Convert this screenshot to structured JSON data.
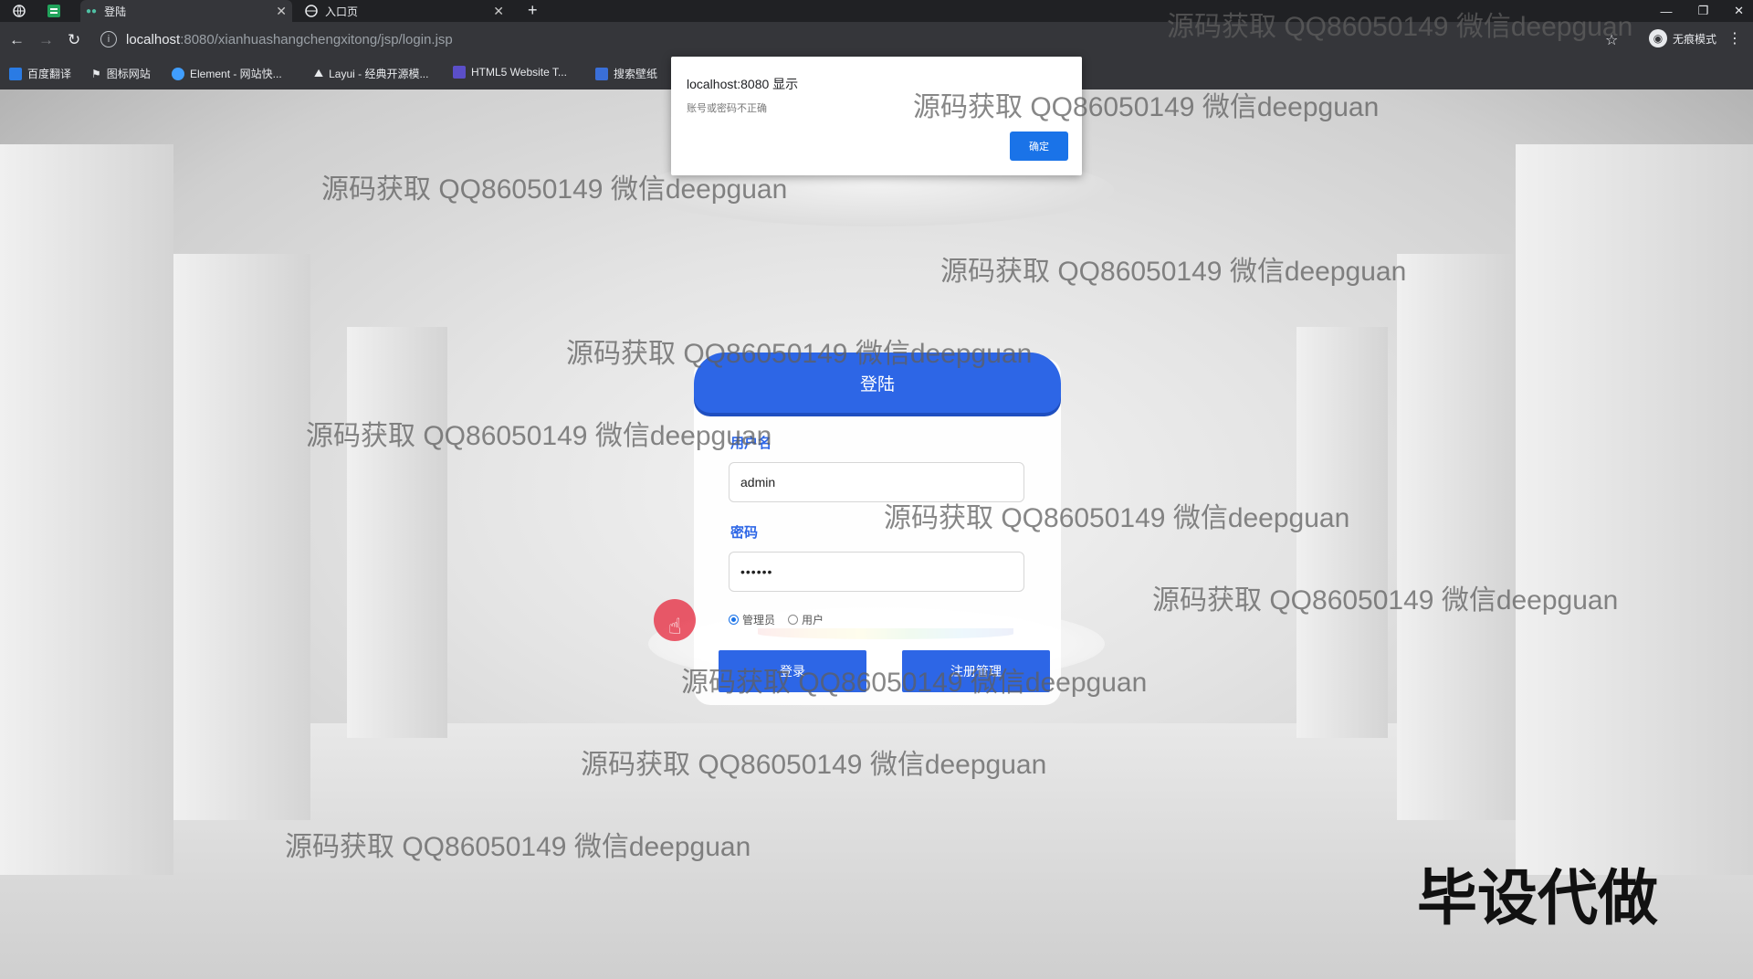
{
  "browser": {
    "tabs": [
      {
        "title": "登陆",
        "active": true
      },
      {
        "title": "入口页",
        "active": false
      }
    ],
    "new_tab": "+",
    "url_host": "localhost",
    "url_path": ":8080/xianhuashangchengxitong/jsp/login.jsp",
    "incognito_label": "无痕模式",
    "bookmarks": [
      "百度翻译",
      "图标网站",
      "Element - 网站快...",
      "Layui - 经典开源模...",
      "HTML5 Website T...",
      "搜索壁纸"
    ]
  },
  "dialog": {
    "title": "localhost:8080 显示",
    "message": "账号或密码不正确",
    "ok_label": "确定"
  },
  "login": {
    "title": "登陆",
    "username_label": "用户名",
    "username_value": "admin",
    "password_label": "密码",
    "password_value": "••••••",
    "roles": [
      {
        "label": "管理员",
        "checked": true
      },
      {
        "label": "用户",
        "checked": false
      }
    ],
    "login_button": "登录",
    "register_button": "注册管理"
  },
  "overlay": {
    "watermark": "源码获取 QQ86050149 微信deepguan",
    "corner_text": "毕设代做"
  },
  "colors": {
    "primary": "#2d66e6",
    "dialog_button": "#1a73e8",
    "chrome_dark": "#202124"
  }
}
